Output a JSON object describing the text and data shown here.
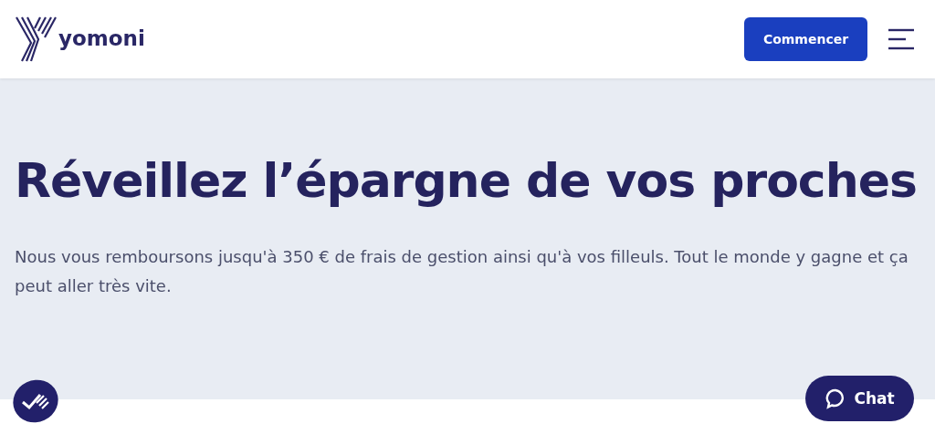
{
  "header": {
    "logo_text": "yomoni",
    "cta": "Commencer"
  },
  "hero": {
    "title": "Réveillez l’épargne de vos proches",
    "text": "Nous vous remboursons jusqu'à 350 € de frais de gestion ainsi qu'à vos filleuls. Tout le monde y gagne et ça peut aller très vite."
  },
  "chat_button": {
    "label": "Chat"
  }
}
